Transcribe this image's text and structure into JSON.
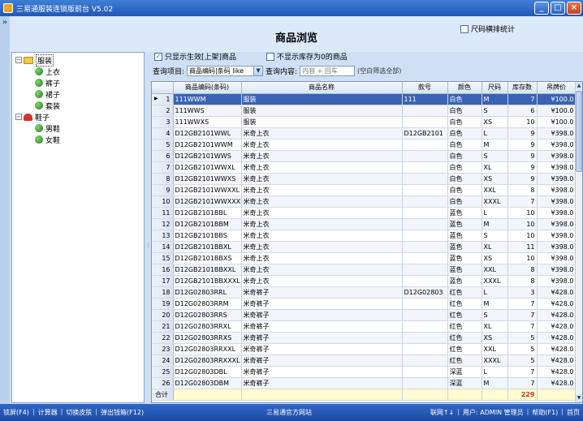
{
  "window": {
    "title": "三易通服装连锁版前台 V5.02",
    "buttons": {
      "minimize": "_",
      "maximize": "□",
      "close": "×"
    }
  },
  "left_strip": {
    "chevron": "»"
  },
  "header": {
    "page_title": "商品浏览",
    "size_stats_label": "尺码横排统计"
  },
  "tree": {
    "nodes": [
      {
        "label": "服装",
        "expander": "−",
        "children": [
          "上衣",
          "裤子",
          "裙子",
          "套装"
        ]
      },
      {
        "label": "鞋子",
        "expander": "−",
        "children": [
          "男鞋",
          "女鞋"
        ]
      }
    ]
  },
  "filters": {
    "show_active_checked": true,
    "show_active_label": "只显示生效[上架]商品",
    "hide_zero_checked": false,
    "hide_zero_label": "不显示库存为0的商品",
    "check_mark": "✓",
    "query_item_label": "查询项目:",
    "query_item_value": "商品编码|条码 like",
    "query_content_label": "查询内容:",
    "query_content_placeholder": "内容 + 回车",
    "query_hint": "(空白筛选全部)"
  },
  "grid": {
    "columns": [
      "",
      "商品编码(条码)",
      "商品名称",
      "款号",
      "颜色",
      "尺码",
      "库存数",
      "吊牌价"
    ],
    "rows": [
      [
        "1",
        "111WWM",
        "服装",
        "111",
        "白色",
        "M",
        "7",
        "¥100.0"
      ],
      [
        "2",
        "111WWS",
        "服装",
        "",
        "白色",
        "S",
        "6",
        "¥100.0"
      ],
      [
        "3",
        "111WWXS",
        "服装",
        "",
        "白色",
        "XS",
        "10",
        "¥100.0"
      ],
      [
        "4",
        "D12GB2101WWL",
        "米奇上衣",
        "D12GB2101",
        "白色",
        "L",
        "9",
        "¥398.0"
      ],
      [
        "5",
        "D12GB2101WWM",
        "米奇上衣",
        "",
        "白色",
        "M",
        "9",
        "¥398.0"
      ],
      [
        "6",
        "D12GB2101WWS",
        "米奇上衣",
        "",
        "白色",
        "S",
        "9",
        "¥398.0"
      ],
      [
        "7",
        "D12GB2101WWXL",
        "米奇上衣",
        "",
        "白色",
        "XL",
        "9",
        "¥398.0"
      ],
      [
        "8",
        "D12GB2101WWXS",
        "米奇上衣",
        "",
        "白色",
        "XS",
        "9",
        "¥398.0"
      ],
      [
        "9",
        "D12GB2101WWXXL",
        "米奇上衣",
        "",
        "白色",
        "XXL",
        "8",
        "¥398.0"
      ],
      [
        "10",
        "D12GB2101WWXXXL",
        "米奇上衣",
        "",
        "白色",
        "XXXL",
        "7",
        "¥398.0"
      ],
      [
        "11",
        "D12GB2101BBL",
        "米奇上衣",
        "",
        "蓝色",
        "L",
        "10",
        "¥398.0"
      ],
      [
        "12",
        "D12GB2101BBM",
        "米奇上衣",
        "",
        "蓝色",
        "M",
        "10",
        "¥398.0"
      ],
      [
        "13",
        "D12GB2101BBS",
        "米奇上衣",
        "",
        "蓝色",
        "S",
        "10",
        "¥398.0"
      ],
      [
        "14",
        "D12GB2101BBXL",
        "米奇上衣",
        "",
        "蓝色",
        "XL",
        "11",
        "¥398.0"
      ],
      [
        "15",
        "D12GB2101BBXS",
        "米奇上衣",
        "",
        "蓝色",
        "XS",
        "10",
        "¥398.0"
      ],
      [
        "16",
        "D12GB2101BBXXL",
        "米奇上衣",
        "",
        "蓝色",
        "XXL",
        "8",
        "¥398.0"
      ],
      [
        "17",
        "D12GB2101BBXXXL",
        "米奇上衣",
        "",
        "蓝色",
        "XXXL",
        "8",
        "¥398.0"
      ],
      [
        "18",
        "D12G02803RRL",
        "米奇裤子",
        "D12G02803",
        "红色",
        "L",
        "3",
        "¥428.0"
      ],
      [
        "19",
        "D12G02803RRM",
        "米奇裤子",
        "",
        "红色",
        "M",
        "7",
        "¥428.0"
      ],
      [
        "20",
        "D12G02803RRS",
        "米奇裤子",
        "",
        "红色",
        "S",
        "7",
        "¥428.0"
      ],
      [
        "21",
        "D12G02803RRXL",
        "米奇裤子",
        "",
        "红色",
        "XL",
        "7",
        "¥428.0"
      ],
      [
        "22",
        "D12G02803RRXS",
        "米奇裤子",
        "",
        "红色",
        "XS",
        "5",
        "¥428.0"
      ],
      [
        "23",
        "D12G02803RRXXL",
        "米奇裤子",
        "",
        "红色",
        "XXL",
        "5",
        "¥428.0"
      ],
      [
        "24",
        "D12G02803RRXXXL",
        "米奇裤子",
        "",
        "红色",
        "XXXL",
        "5",
        "¥428.0"
      ],
      [
        "25",
        "D12G02803DBL",
        "米奇裤子",
        "",
        "深蓝",
        "L",
        "7",
        "¥428.0"
      ],
      [
        "26",
        "D12G02803DBM",
        "米奇裤子",
        "",
        "深蓝",
        "M",
        "7",
        "¥428.0"
      ]
    ],
    "selected_row_index": 0,
    "row_pointer": "▶",
    "total_label": "合计",
    "total_stock": "229"
  },
  "statusbar": {
    "left_items": [
      "锁屏(F4)",
      "计算器",
      "切换皮肤",
      "弹出钱箱(F12)"
    ],
    "center": "三易通官方网站",
    "right_items": [
      "联网↑↓",
      "用户: ADMIN 管理员",
      "帮助(F1)",
      "首页"
    ],
    "separator": "|"
  }
}
